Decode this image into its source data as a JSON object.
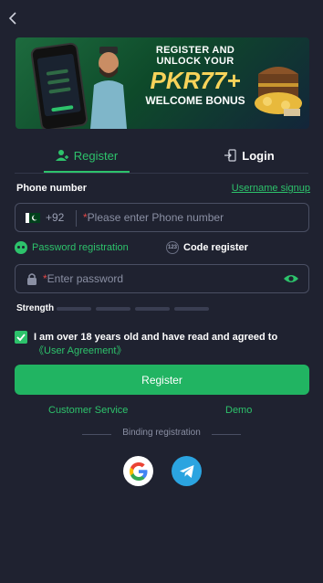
{
  "header": {
    "back_icon": "chevron-left-icon"
  },
  "banner": {
    "line1": "REGISTER AND UNLOCK YOUR",
    "line2": "PKR77+",
    "line3": "WELCOME BONUS"
  },
  "tabs": {
    "register": "Register",
    "login": "Login"
  },
  "phone": {
    "label": "Phone number",
    "username_link": "Username signup",
    "country_code": "+92",
    "placeholder_star": "*",
    "placeholder": "Please enter Phone number"
  },
  "registration_modes": {
    "password": "Password registration",
    "code": "Code register",
    "code_icon_text": "123"
  },
  "password": {
    "placeholder_star": "*",
    "placeholder": "Enter password"
  },
  "strength": {
    "label": "Strength",
    "segments": 4,
    "level": 0
  },
  "agreement": {
    "checked": true,
    "text": "I am over 18 years old and have read and agreed to ",
    "link": "《User Agreement》"
  },
  "register_button": "Register",
  "links": {
    "customer_service": "Customer Service",
    "demo": "Demo"
  },
  "binding_label": "Binding registration",
  "colors": {
    "accent": "#2dc26b",
    "background": "#1f2230",
    "telegram": "#2ba4e0"
  }
}
